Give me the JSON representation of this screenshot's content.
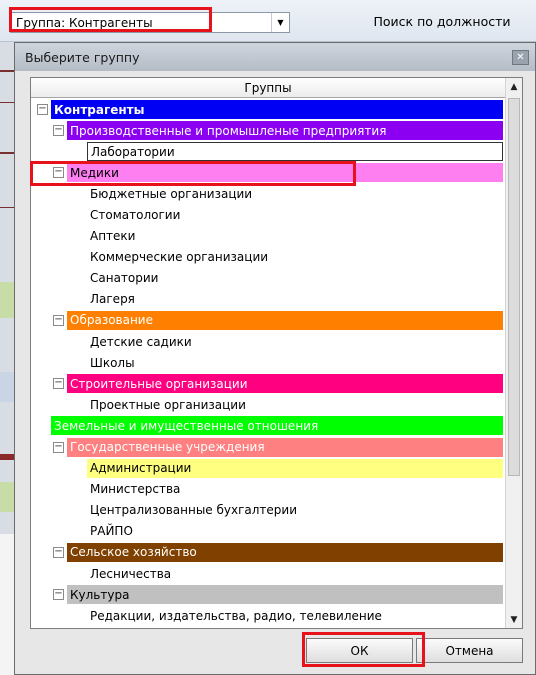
{
  "toolbar": {
    "group_combo_value": "Группа: Контрагенты",
    "search_by_position_label": "Поиск по должности"
  },
  "dialog": {
    "title": "Выберите группу",
    "column_header": "Группы",
    "ok_label": "ОК",
    "cancel_label": "Отмена"
  },
  "tree": [
    {
      "label": "Контрагенты",
      "level": 0,
      "toggle": "minus",
      "bg": "#0000f5",
      "color": "#ffffff",
      "bold": true
    },
    {
      "label": "Производственные и промышленые предприятия",
      "level": 1,
      "toggle": "minus",
      "bg": "#8c00f2",
      "color": "#ffffff"
    },
    {
      "label": "Лаборатории",
      "level": 2,
      "toggle": "none",
      "bg": "#ffffff",
      "color": "#000000",
      "selected": true
    },
    {
      "label": "Медики",
      "level": 1,
      "toggle": "minus",
      "bg": "#fe7ff0",
      "color": "#000000"
    },
    {
      "label": "Бюджетные организации",
      "level": 2,
      "toggle": "none",
      "bg": "#ffffff",
      "color": "#000000"
    },
    {
      "label": "Стоматологии",
      "level": 2,
      "toggle": "none",
      "bg": "#ffffff",
      "color": "#000000"
    },
    {
      "label": "Аптеки",
      "level": 2,
      "toggle": "none",
      "bg": "#ffffff",
      "color": "#000000"
    },
    {
      "label": "Коммерческие организации",
      "level": 2,
      "toggle": "none",
      "bg": "#ffffff",
      "color": "#000000"
    },
    {
      "label": "Санатории",
      "level": 2,
      "toggle": "none",
      "bg": "#ffffff",
      "color": "#000000"
    },
    {
      "label": "Лагеря",
      "level": 2,
      "toggle": "none",
      "bg": "#ffffff",
      "color": "#000000"
    },
    {
      "label": "Образование",
      "level": 1,
      "toggle": "minus",
      "bg": "#ff8000",
      "color": "#ffffff"
    },
    {
      "label": "Детские садики",
      "level": 2,
      "toggle": "none",
      "bg": "#ffffff",
      "color": "#000000"
    },
    {
      "label": "Школы",
      "level": 2,
      "toggle": "none",
      "bg": "#ffffff",
      "color": "#000000"
    },
    {
      "label": "Строительные организации",
      "level": 1,
      "toggle": "minus",
      "bg": "#ff0080",
      "color": "#ffffff"
    },
    {
      "label": "Проектные организации",
      "level": 2,
      "toggle": "none",
      "bg": "#ffffff",
      "color": "#000000"
    },
    {
      "label": "Земельные и имущественные отношения",
      "level": 0.7,
      "toggle": "none",
      "bg": "#00ff00",
      "color": "#ffffff"
    },
    {
      "label": "Государственные учреждения",
      "level": 1,
      "toggle": "minus",
      "bg": "#ff8080",
      "color": "#ffffff"
    },
    {
      "label": "Администрации",
      "level": 2,
      "toggle": "none",
      "bg": "#ffff80",
      "color": "#000000"
    },
    {
      "label": "Министерства",
      "level": 2,
      "toggle": "none",
      "bg": "#ffffff",
      "color": "#000000"
    },
    {
      "label": "Централизованные бухгалтерии",
      "level": 2,
      "toggle": "none",
      "bg": "#ffffff",
      "color": "#000000"
    },
    {
      "label": "РАЙПО",
      "level": 2,
      "toggle": "none",
      "bg": "#ffffff",
      "color": "#000000"
    },
    {
      "label": "Сельское хозяйство",
      "level": 1,
      "toggle": "minus",
      "bg": "#804000",
      "color": "#ffffff"
    },
    {
      "label": "Лесничества",
      "level": 2,
      "toggle": "none",
      "bg": "#ffffff",
      "color": "#000000"
    },
    {
      "label": "Культура",
      "level": 1,
      "toggle": "minus",
      "bg": "#c0c0c0",
      "color": "#000000"
    },
    {
      "label": "Редакции, издательства, радио, телевиление",
      "level": 2,
      "toggle": "none",
      "bg": "#ffffff",
      "color": "#000000"
    }
  ],
  "icons": {
    "dropdown": "chevron-down-icon",
    "close": "close-icon",
    "scroll_up": "arrow-up-icon",
    "scroll_down": "arrow-down-icon",
    "tree_toggle": "minus-box-icon"
  },
  "colors": {
    "highlight": "#e8121c"
  }
}
